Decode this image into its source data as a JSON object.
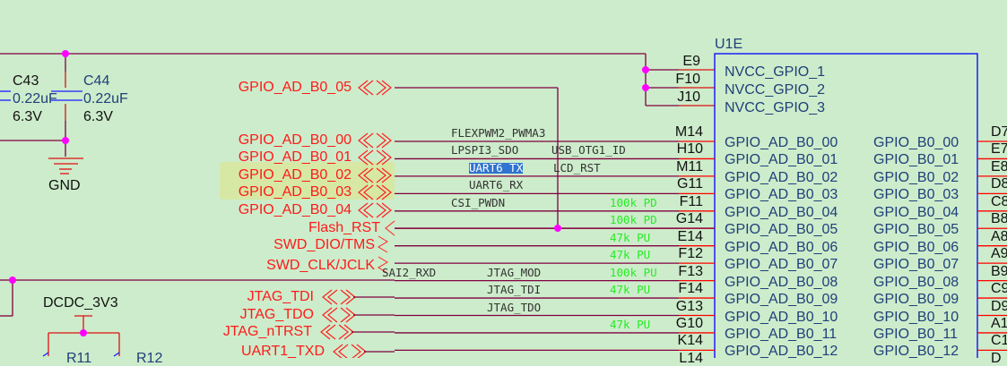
{
  "component": {
    "ref": "U1E",
    "power_pins": [
      {
        "pin": "E9",
        "name": "NVCC_GPIO_1"
      },
      {
        "pin": "F10",
        "name": "NVCC_GPIO_2"
      },
      {
        "pin": "J10",
        "name": "NVCC_GPIO_3"
      }
    ]
  },
  "rows": [
    {
      "pin": "M14",
      "func_a": "FLEXPWM2_PWMA3",
      "func_b": "",
      "pull": "",
      "ad": "GPIO_AD_B0_00",
      "b0": "GPIO_B0_00",
      "rpin": "D7"
    },
    {
      "pin": "H10",
      "func_a": "LPSPI3_SDO",
      "func_b": "USB_OTG1_ID",
      "pull": "",
      "ad": "GPIO_AD_B0_01",
      "b0": "GPIO_B0_01",
      "rpin": "E7"
    },
    {
      "pin": "M11",
      "func_a": "UART6_TX",
      "func_b": "LCD_RST",
      "pull": "",
      "ad": "GPIO_AD_B0_02",
      "b0": "GPIO_B0_02",
      "rpin": "E8",
      "selected": true
    },
    {
      "pin": "G11",
      "func_a": "UART6_RX",
      "func_b": "",
      "pull": "",
      "ad": "GPIO_AD_B0_03",
      "b0": "GPIO_B0_03",
      "rpin": "D8"
    },
    {
      "pin": "F11",
      "func_a": "CSI_PWDN",
      "func_b": "",
      "pull": "100k PD",
      "ad": "GPIO_AD_B0_04",
      "b0": "GPIO_B0_04",
      "rpin": "C8"
    },
    {
      "pin": "G14",
      "func_a": "",
      "func_b": "",
      "pull": "100k PD",
      "ad": "GPIO_AD_B0_05",
      "b0": "GPIO_B0_05",
      "rpin": "B8"
    },
    {
      "pin": "E14",
      "func_a": "",
      "func_b": "",
      "pull": "47k PU",
      "ad": "GPIO_AD_B0_06",
      "b0": "GPIO_B0_06",
      "rpin": "A8"
    },
    {
      "pin": "F12",
      "func_a": "",
      "func_b": "",
      "pull": "47k PU",
      "ad": "GPIO_AD_B0_07",
      "b0": "GPIO_B0_07",
      "rpin": "A9"
    },
    {
      "pin": "F13",
      "func_a": "SAI2_RXD",
      "func_b": "JTAG_MOD",
      "pull": "100k PU",
      "ad": "GPIO_AD_B0_08",
      "b0": "GPIO_B0_08",
      "rpin": "B9"
    },
    {
      "pin": "F14",
      "func_a": "",
      "func_b": "JTAG_TDI",
      "pull": "47k PU",
      "ad": "GPIO_AD_B0_09",
      "b0": "GPIO_B0_09",
      "rpin": "C9"
    },
    {
      "pin": "G13",
      "func_a": "",
      "func_b": "JTAG_TDO",
      "pull": "",
      "ad": "GPIO_AD_B0_10",
      "b0": "GPIO_B0_10",
      "rpin": "D9"
    },
    {
      "pin": "G10",
      "func_a": "",
      "func_b": "",
      "pull": "47k PU",
      "ad": "GPIO_AD_B0_11",
      "b0": "GPIO_B0_11",
      "rpin": "A1"
    },
    {
      "pin": "K14",
      "func_a": "",
      "func_b": "",
      "pull": "",
      "ad": "GPIO_AD_B0_12",
      "b0": "GPIO_B0_12",
      "rpin": "C1"
    },
    {
      "pin": "L14",
      "func_a": "",
      "func_b": "",
      "pull": "",
      "ad": "",
      "b0": "",
      "rpin": "D"
    }
  ],
  "net_labels": {
    "b0_05": "GPIO_AD_B0_05",
    "b0_00": "GPIO_AD_B0_00",
    "b0_01": "GPIO_AD_B0_01",
    "b0_02": "GPIO_AD_B0_02",
    "b0_03": "GPIO_AD_B0_03",
    "b0_04": "GPIO_AD_B0_04",
    "flash_rst": "Flash_RST",
    "swd_dio": "SWD_DIO/TMS",
    "swd_clk": "SWD_CLK/JCLK",
    "jtag_tdi": "JTAG_TDI",
    "jtag_tdo": "JTAG_TDO",
    "jtag_ntrst": "JTAG_nTRST",
    "uart1_txd": "UART1_TXD"
  },
  "capacitors": [
    {
      "ref": "C43",
      "value": "0.22uF",
      "voltage": "6.3V"
    },
    {
      "ref": "C44",
      "value": "0.22uF",
      "voltage": "6.3V"
    }
  ],
  "power": {
    "gnd": "GND",
    "dcdc": "DCDC_3V3"
  },
  "resistors": [
    "R11",
    "R12"
  ],
  "colors": {
    "background": "#cdeccb",
    "wire": "#800040",
    "pin": "#ff0000",
    "body": "#0000ff",
    "net_label": "#ff1a1a",
    "pull": "#22ee22"
  }
}
